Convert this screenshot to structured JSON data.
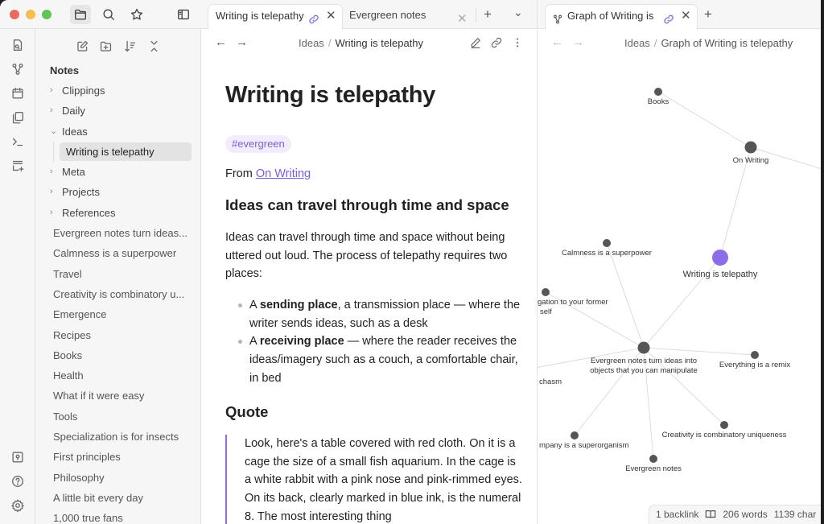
{
  "window": {
    "traffic_lights": {
      "close": "#ed6a5e",
      "minimize": "#f5bf4f",
      "zoom": "#61c554"
    }
  },
  "left_toolbar": {
    "icons": [
      "folder-icon",
      "search-icon",
      "star-icon",
      "sidebar-toggle-icon"
    ]
  },
  "ribbon": {
    "top_icons": [
      "file-search-icon",
      "graph-icon",
      "calendar-icon",
      "copy-icon",
      "terminal-icon",
      "new-canvas-icon"
    ],
    "bottom_icons": [
      "vault-icon",
      "help-icon",
      "settings-icon"
    ]
  },
  "sidebar": {
    "tools": [
      "new-note-icon",
      "new-folder-icon",
      "sort-icon",
      "collapse-all-icon"
    ],
    "vault_name": "Notes",
    "folders": [
      {
        "label": "Clippings",
        "expanded": false
      },
      {
        "label": "Daily",
        "expanded": false
      },
      {
        "label": "Ideas",
        "expanded": true,
        "children": [
          "Writing is telepathy"
        ]
      },
      {
        "label": "Meta",
        "expanded": false
      },
      {
        "label": "Projects",
        "expanded": false
      },
      {
        "label": "References",
        "expanded": false
      }
    ],
    "files": [
      "Evergreen notes turn ideas...",
      "Calmness is a superpower",
      "Travel",
      "Creativity is combinatory u...",
      "Emergence",
      "Recipes",
      "Books",
      "Health",
      "What if it were easy",
      "Tools",
      "Specialization is for insects",
      "First principles",
      "Philosophy",
      "A little bit every day",
      "1,000 true fans"
    ]
  },
  "editor_tabs": {
    "tabs": [
      {
        "label": "Writing is telepathy",
        "active": true,
        "linked": true
      },
      {
        "label": "Evergreen notes",
        "active": false
      }
    ],
    "new_tab": "+",
    "menu": "⌄"
  },
  "graph_tabs": {
    "tabs": [
      {
        "label": "Graph of Writing is telepathy",
        "active": true,
        "linked": true
      }
    ],
    "new_tab": "+"
  },
  "editor_nav": {
    "back": "←",
    "forward": "→",
    "parent": "Ideas",
    "separator": "/",
    "current": "Writing is telepathy"
  },
  "graph_nav": {
    "back": "←",
    "forward": "→",
    "parent": "Ideas",
    "separator": "/",
    "current": "Graph of Writing is telepathy"
  },
  "document": {
    "title": "Writing is telepathy",
    "tag": "#evergreen",
    "from_prefix": "From ",
    "from_link": "On Writing",
    "heading1": "Ideas can travel through time and space",
    "paragraph": "Ideas can travel through time and space without being uttered out loud. The process of telepathy requires two places:",
    "bullets": [
      {
        "prefix": "A ",
        "bold": "sending place",
        "rest": ", a transmission place — where the writer sends ideas, such as a desk"
      },
      {
        "prefix": "A ",
        "bold": "receiving place",
        "rest": " — where the reader receives the ideas/imagery such as a couch, a comfortable chair, in bed"
      }
    ],
    "heading2": "Quote",
    "quote": "Look, here's a table covered with red cloth. On it is a cage the size of a small fish aquarium. In the cage is a white rabbit with a pink nose and pink-rimmed eyes. On its back, clearly marked in blue ink, is the numeral 8. The most interesting thing"
  },
  "graph": {
    "accent": "#8a6ee8",
    "node_color": "#555555",
    "nodes": [
      {
        "id": "books",
        "label": "Books"
      },
      {
        "id": "on-writing",
        "label": "On Writing"
      },
      {
        "id": "writing-telepathy",
        "label": "Writing is telepathy",
        "current": true
      },
      {
        "id": "calmness",
        "label": "Calmness is a superpower"
      },
      {
        "id": "obligation",
        "label": [
          "gation to your former",
          "self"
        ]
      },
      {
        "id": "evergreen-turn",
        "label": [
          "Evergreen notes turn ideas into",
          "objects that you can manipulate"
        ]
      },
      {
        "id": "remix",
        "label": "Everything is a remix"
      },
      {
        "id": "chasm",
        "label": "chasm"
      },
      {
        "id": "superorganism",
        "label": "mpany is a superorganism"
      },
      {
        "id": "creativity",
        "label": "Creativity is combinatory uniqueness"
      },
      {
        "id": "evergreen-notes",
        "label": "Evergreen notes"
      }
    ],
    "edges": [
      [
        "books",
        "on-writing"
      ],
      [
        "on-writing",
        "offscreen-right"
      ],
      [
        "on-writing",
        "writing-telepathy"
      ],
      [
        "writing-telepathy",
        "evergreen-turn"
      ],
      [
        "calmness",
        "evergreen-turn"
      ],
      [
        "obligation",
        "evergreen-turn"
      ],
      [
        "chasm",
        "evergreen-turn"
      ],
      [
        "remix",
        "evergreen-turn"
      ],
      [
        "superorganism",
        "evergreen-turn"
      ],
      [
        "creativity",
        "evergreen-turn"
      ],
      [
        "evergreen-notes",
        "evergreen-turn"
      ]
    ]
  },
  "status": {
    "backlinks": "1 backlink",
    "words": "206 words",
    "chars": "1139 char"
  }
}
